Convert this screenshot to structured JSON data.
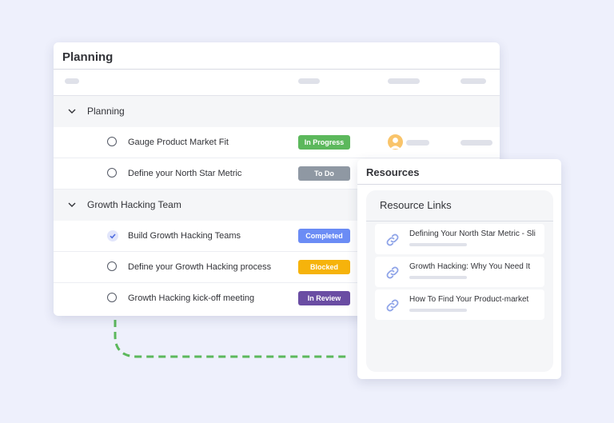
{
  "planning_board": {
    "title": "Planning",
    "groups": [
      {
        "name": "Planning",
        "tasks": [
          {
            "name": "Gauge Product Market Fit",
            "done": false,
            "status": "In Progress",
            "status_color": "#5cb85c",
            "has_owner": true
          },
          {
            "name": "Define your North Star Metric",
            "done": false,
            "status": "To Do",
            "status_color": "#8f98a3",
            "has_owner": false
          }
        ]
      },
      {
        "name": "Growth Hacking Team",
        "tasks": [
          {
            "name": "Build Growth Hacking Teams",
            "done": true,
            "status": "Completed",
            "status_color": "#6b8cf5"
          },
          {
            "name": "Define your Growth Hacking process",
            "done": false,
            "status": "Blocked",
            "status_color": "#f6b30b"
          },
          {
            "name": "Growth Hacking kick-off meeting",
            "done": false,
            "status": "In Review",
            "status_color": "#6a4da3"
          }
        ]
      }
    ]
  },
  "resources": {
    "title": "Resources",
    "panel_title": "Resource Links",
    "links": [
      {
        "text": "Defining Your North Star Metric - Sli"
      },
      {
        "text": "Growth Hacking: Why You Need It"
      },
      {
        "text": "How To Find Your Product-market"
      }
    ]
  },
  "colors": {
    "background": "#eef0fc",
    "connector": "#5cb85c",
    "link_icon": "#8fa4e8",
    "check": "#4f6de0"
  },
  "icons": {
    "group_toggle": "chevron-down-icon",
    "task_open": "circle-icon",
    "task_done": "check-circle-icon",
    "link": "link-icon",
    "owner": "avatar"
  }
}
